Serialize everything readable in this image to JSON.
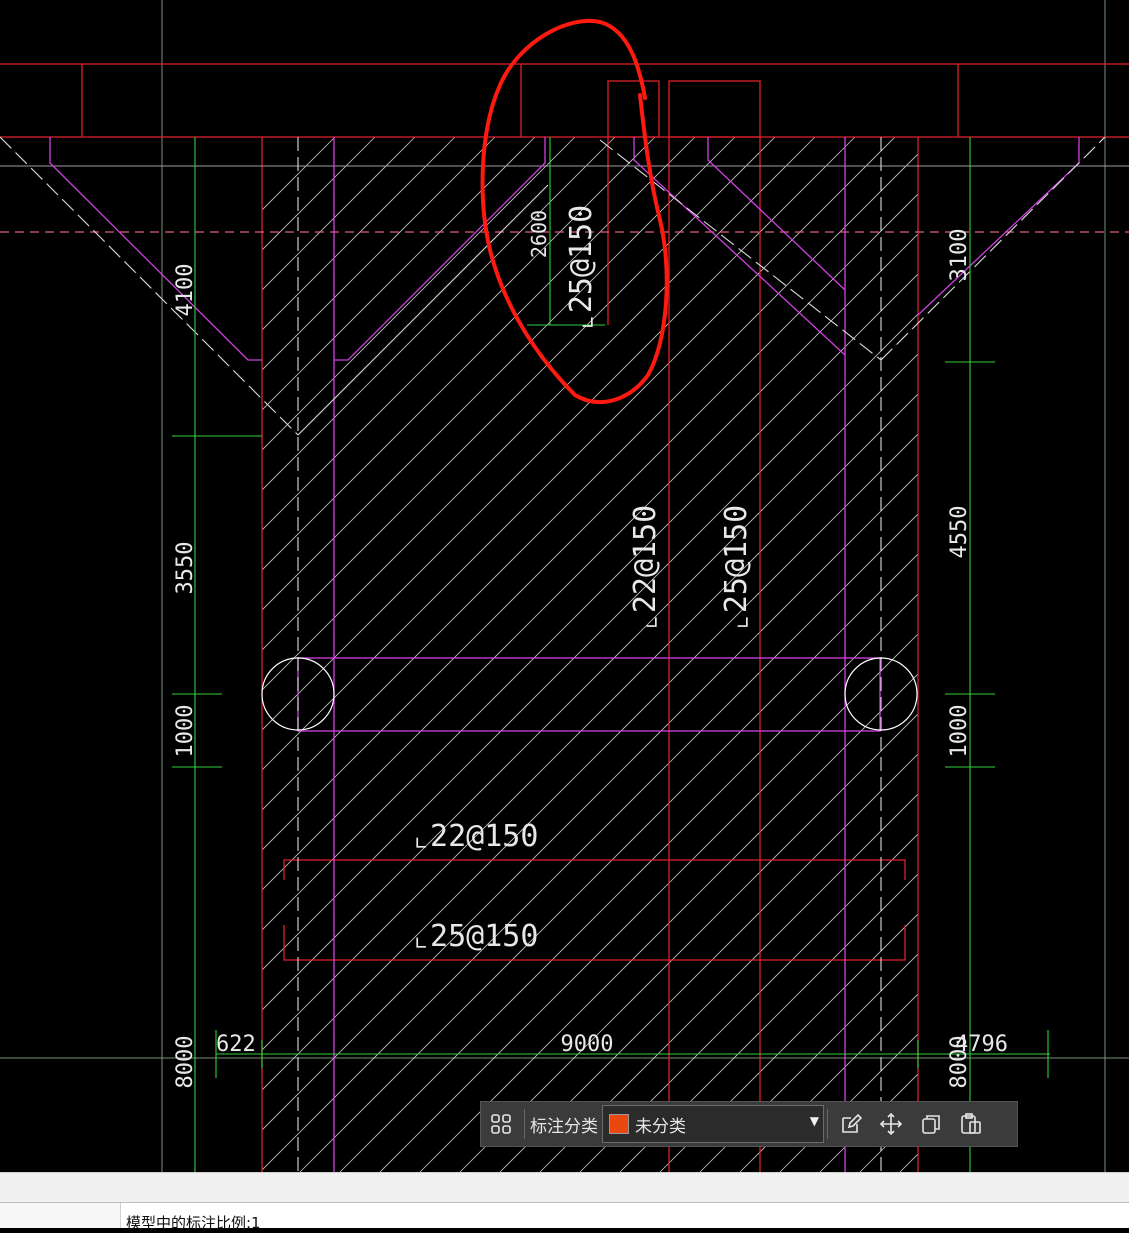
{
  "drawing": {
    "dims_left": [
      "4100",
      "3550",
      "1000",
      "8000"
    ],
    "dims_right": [
      "3100",
      "4550",
      "1000",
      "8000"
    ],
    "dims_bottom": [
      "622",
      "9000",
      "4796"
    ],
    "dim_top_inner": "2600",
    "rebar_top": "⌞25@150",
    "rebar_mid_1": "⌞22@150",
    "rebar_mid_2": "⌞25@150",
    "rebar_bottom_1": "⌞22@150",
    "rebar_bottom_2": "⌞25@150",
    "colors": {
      "boundary": "#e0202a",
      "wall": "#d040e0",
      "dimension": "#30d040",
      "hatch": "#c8c8c8",
      "annotation_circle": "#ff1a10"
    }
  },
  "toolbar": {
    "grid_icon": "four-squares-icon",
    "label": "标注分类",
    "category_value": "未分类",
    "category_color": "#e8480e",
    "edit_icon": "edit-icon",
    "move_icon": "move-icon",
    "copy_icon": "copy-icon",
    "paste_icon": "paste-icon"
  },
  "status": {
    "scale_text": "模型中的标注比例:1"
  }
}
